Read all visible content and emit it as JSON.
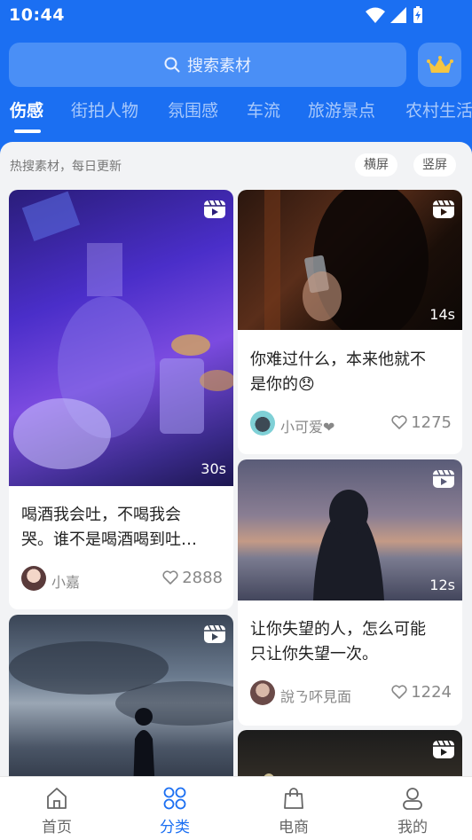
{
  "status_bar": {
    "time": "10:44"
  },
  "search": {
    "placeholder": "搜索素材"
  },
  "tabs": [
    "伤感",
    "街拍人物",
    "氛围感",
    "车流",
    "旅游景点",
    "农村生活"
  ],
  "feed": {
    "hint": "热搜素材，每日更新",
    "filters": [
      "横屏",
      "竖屏"
    ],
    "cards": [
      {
        "caption_line1": "喝酒我会吐，不喝我会",
        "caption_line2": "哭。谁不是喝酒喝到吐…",
        "user": "小嘉",
        "likes": "2888",
        "duration": "30s"
      },
      {
        "caption_line1": "你难过什么，本来他就不",
        "caption_line2": "是你的😞",
        "user": "小可爱❤",
        "likes": "1275",
        "duration": "14s"
      },
      {
        "caption_line1": "让你失望的人，怎么可能",
        "caption_line2": "只让你失望一次。",
        "user": "說ㄋ吥見面",
        "likes": "1224",
        "duration": "12s"
      }
    ]
  },
  "bottom_nav": [
    {
      "label": "首页",
      "icon": "home-icon"
    },
    {
      "label": "分类",
      "icon": "category-icon"
    },
    {
      "label": "电商",
      "icon": "shopping-bag-icon"
    },
    {
      "label": "我的",
      "icon": "profile-icon"
    }
  ],
  "colors": {
    "primary": "#1b6ff2",
    "search_bg": "#4a8ff6"
  }
}
